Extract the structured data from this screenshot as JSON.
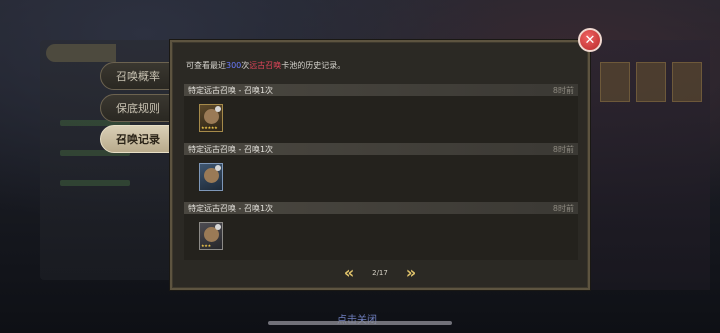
{
  "side_tabs": {
    "top_label": "",
    "items": [
      {
        "label": "召唤概率",
        "active": false
      },
      {
        "label": "保底规则",
        "active": false
      },
      {
        "label": "召唤记录",
        "active": true
      }
    ]
  },
  "info": {
    "prefix": "可查看最近",
    "count": "300",
    "middle": "次",
    "pool": "远古召唤",
    "suffix": "卡池的历史记录。"
  },
  "records": [
    {
      "title": "特定远古召唤 - 召唤1次",
      "time": "8时前",
      "card": {
        "icon": "hero-card-icon",
        "stars": "★★★★★"
      }
    },
    {
      "title": "特定远古召唤 - 召唤1次",
      "time": "8时前",
      "card": {
        "icon": "hero-card-icon",
        "stars": ""
      }
    },
    {
      "title": "特定远古召唤 - 召唤1次",
      "time": "8时前",
      "card": {
        "icon": "hero-card-icon",
        "stars": "★★★"
      }
    }
  ],
  "pager": {
    "prev": "«",
    "page": "2/17",
    "next": "»"
  },
  "close_symbol": "✕",
  "tap_close": "点击关闭"
}
